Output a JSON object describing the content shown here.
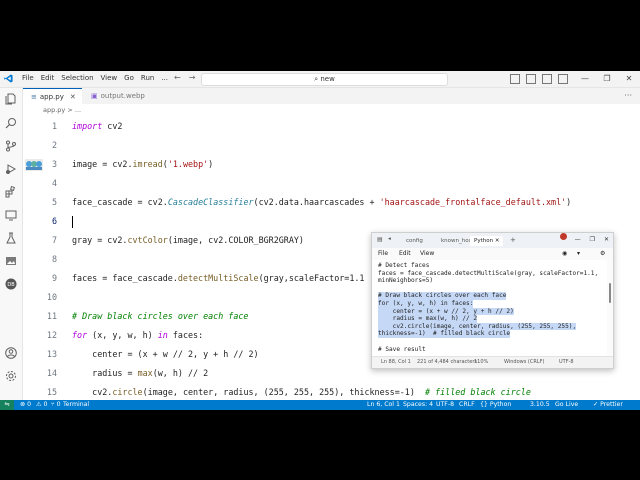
{
  "window": {
    "menu": [
      "File",
      "Edit",
      "Selection",
      "View",
      "Go",
      "Run",
      "..."
    ],
    "nav_back": "←",
    "nav_forward": "→",
    "search_text": "new",
    "controls": [
      "—",
      "❐",
      "✕"
    ]
  },
  "activity_bar": [
    "explorer-icon",
    "search-icon",
    "source-control-icon",
    "run-debug-icon",
    "extensions-icon",
    "remote-icon",
    "testing-icon",
    "image-icon",
    "docker-icon",
    "account-icon",
    "settings-icon"
  ],
  "tabs": [
    {
      "label": "app.py",
      "close": "✕"
    },
    {
      "label": "output.webp"
    }
  ],
  "breadcrumb": {
    "file": "app.py",
    "sep": ">",
    "more": "..."
  },
  "editor": {
    "current_line": 6,
    "lines": [
      {
        "n": "1",
        "t": "import cv2"
      },
      {
        "n": "2",
        "t": ""
      },
      {
        "n": "3",
        "t": "image = cv2.imread('1.webp')"
      },
      {
        "n": "4",
        "t": ""
      },
      {
        "n": "5",
        "t": "face_cascade = cv2.CascadeClassifier(cv2.data.haarcascades + 'haarcascade_frontalface_default.xml')"
      },
      {
        "n": "6",
        "t": ""
      },
      {
        "n": "7",
        "t": "gray = cv2.cvtColor(image, cv2.COLOR_BGR2GRAY)"
      },
      {
        "n": "8",
        "t": ""
      },
      {
        "n": "9",
        "t": "faces = face_cascade.detectMultiScale(gray,scaleFactor=1.1"
      },
      {
        "n": "10",
        "t": ""
      },
      {
        "n": "11",
        "t": "# Draw black circles over each face"
      },
      {
        "n": "12",
        "t": "for (x, y, w, h) in faces:"
      },
      {
        "n": "13",
        "t": "    center = (x + w // 2, y + h // 2)"
      },
      {
        "n": "14",
        "t": "    radius = max(w, h) // 2"
      },
      {
        "n": "15",
        "t": "    cv2.circle(image, center, radius, (255, 255, 255), thickness=-1)  # filled black circle"
      }
    ]
  },
  "notepad": {
    "tabs": [
      "config",
      "known_host",
      "Python"
    ],
    "active_tab": "Python",
    "tab_close": "✕",
    "add_tab": "+",
    "controls": [
      "—",
      "❐",
      "✕"
    ],
    "menu": [
      "File",
      "Edit",
      "View"
    ],
    "lines": [
      {
        "t": "# Detect faces",
        "sel": false
      },
      {
        "t": "faces = face_cascade.detectMultiScale(gray, scaleFactor=1.1,",
        "sel": false
      },
      {
        "t": "minNeighbors=5)",
        "sel": false
      },
      {
        "t": "",
        "sel": false
      },
      {
        "t": "# Draw black circles over each face",
        "sel": true
      },
      {
        "t": "for (x, y, w, h) in faces:",
        "sel": true
      },
      {
        "t": "    center = (x + w // 2, y + h // 2)",
        "sel": true
      },
      {
        "t": "    radius = max(w, h) // 2",
        "sel": true
      },
      {
        "t": "    cv2.circle(image, center, radius, (255, 255, 255),",
        "sel": true
      },
      {
        "t": "thickness=-1)  # filled black circle",
        "sel": true
      },
      {
        "t": "",
        "sel": false
      },
      {
        "t": "# Save result",
        "sel": false
      }
    ],
    "status": {
      "position": "Ln 88, Col 1",
      "chars": "221 of 4,484 characters",
      "zoom": "110%",
      "eol": "Windows (CRLF)",
      "encoding": "UTF-8"
    }
  },
  "statusbar": {
    "errors": "⊗ 0",
    "warnings": "⚠ 0",
    "ports": "⑂ 0",
    "terminal": "Terminal",
    "position": "Ln 6, Col 1",
    "spaces": "Spaces: 4",
    "encoding": "UTF-8",
    "eol": "CRLF",
    "language": "{} Python",
    "version": "3.10.5",
    "golive": "Go Live",
    "prettier": "✓ Prettier"
  }
}
